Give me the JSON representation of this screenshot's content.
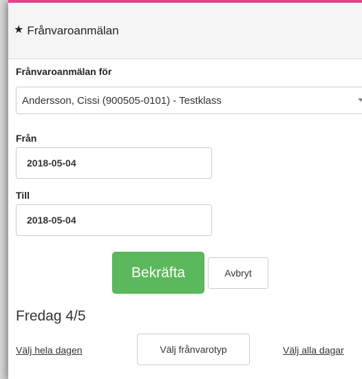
{
  "header": {
    "icon": "star-icon",
    "title": "Frånvaroanmälan"
  },
  "form": {
    "for_label": "Frånvaroanmälan för",
    "student_select_value": "Andersson, Cissi (900505-0101) - Testklass",
    "from_label": "Från",
    "from_value": "2018-05-04",
    "to_label": "Till",
    "to_value": "2018-05-04",
    "confirm_label": "Bekräfta",
    "cancel_label": "Avbryt"
  },
  "day": {
    "heading": "Fredag 4/5",
    "select_whole_day_label": "Välj hela dagen",
    "select_absence_type_label": "Välj frånvarotyp",
    "select_all_days_label": "Välj alla dagar"
  },
  "colors": {
    "accent_top": "#e83e8c",
    "confirm_green": "#5cb85c"
  }
}
